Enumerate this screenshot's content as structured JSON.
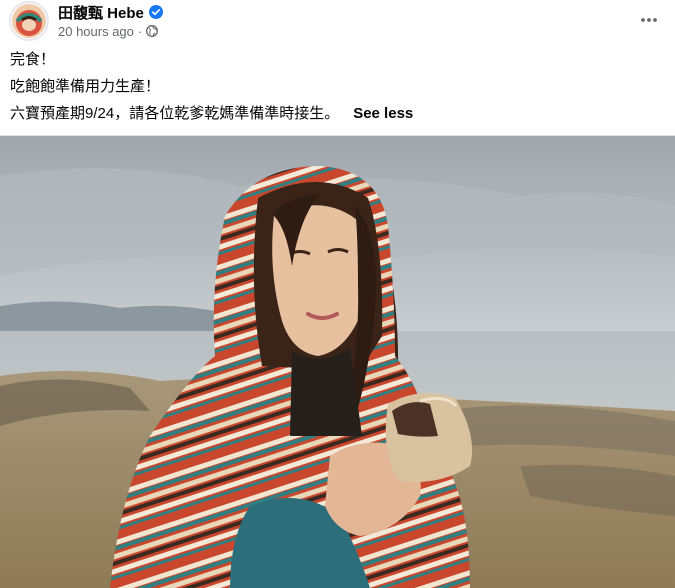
{
  "post": {
    "author": "田馥甄 Hebe",
    "timestamp": "20 hours ago",
    "separator": "·",
    "lines": [
      "完食！",
      "吃飽飽準備用力生產！",
      "六寶預產期9/24，請各位乾爹乾媽準備準時接生。"
    ],
    "see_less": "See less",
    "icons": {
      "verified": "verified-badge-icon",
      "audience": "globe-icon",
      "more": "more-options-icon"
    },
    "colors": {
      "accent": "#1877f2",
      "secondary_text": "#65676b",
      "primary_text": "#050505"
    }
  }
}
